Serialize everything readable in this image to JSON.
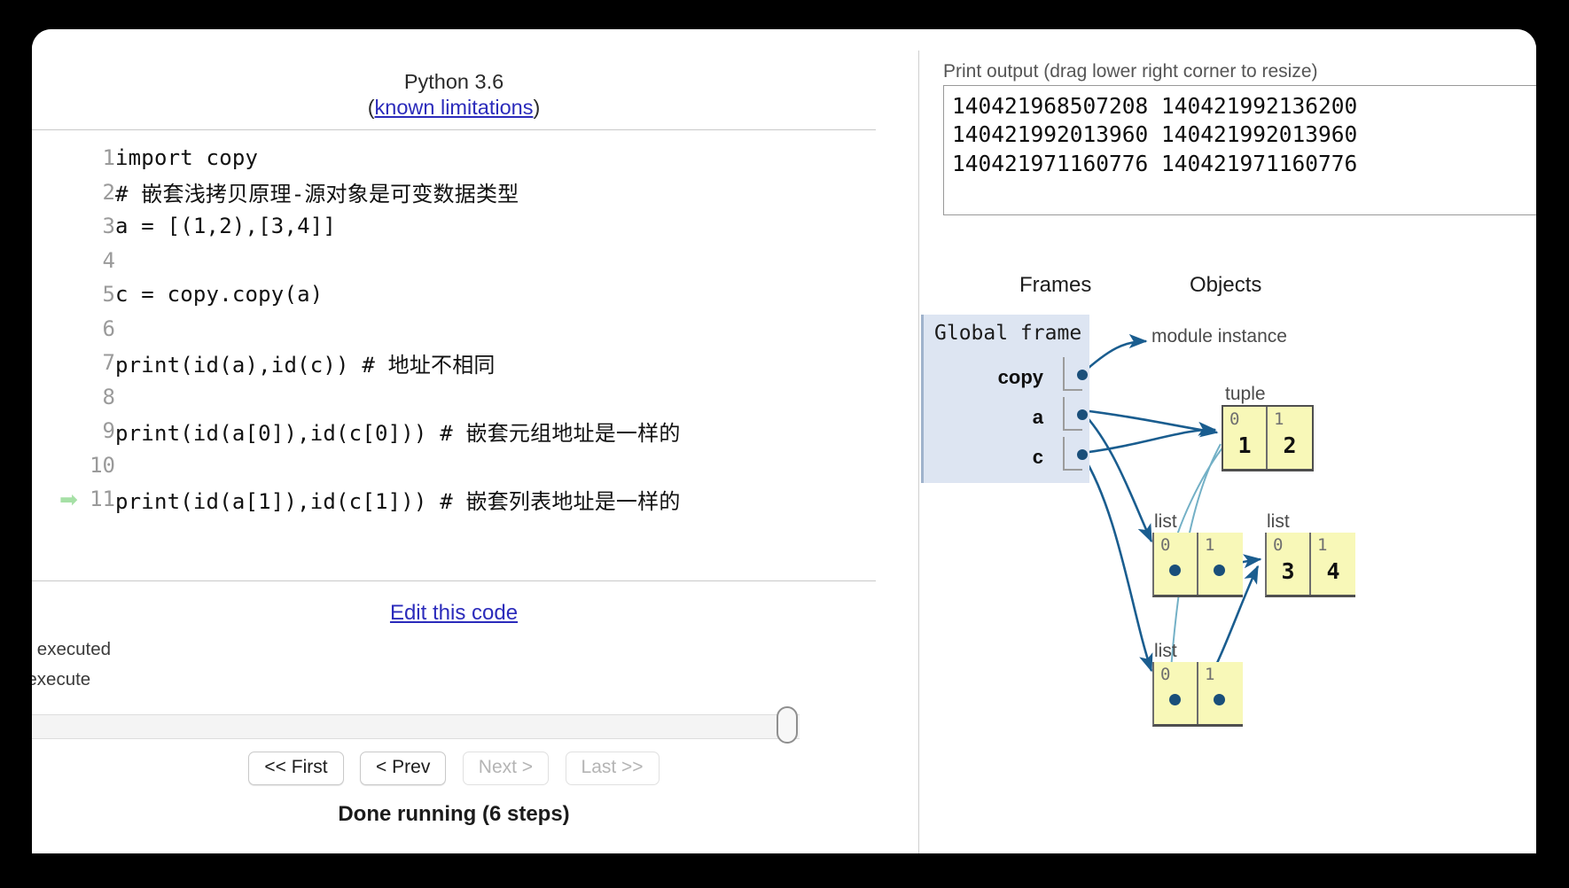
{
  "code_panel": {
    "python_version": "Python 3.6",
    "limitations_open_paren": "(",
    "limitations_link": "known limitations",
    "limitations_close_paren": ")",
    "lines": [
      {
        "number": "1",
        "text": "import copy",
        "current": false
      },
      {
        "number": "2",
        "text": "# 嵌套浅拷贝原理-源对象是可变数据类型",
        "current": false
      },
      {
        "number": "3",
        "text": "a = [(1,2),[3,4]]",
        "current": false
      },
      {
        "number": "4",
        "text": "",
        "current": false
      },
      {
        "number": "5",
        "text": "c = copy.copy(a)",
        "current": false
      },
      {
        "number": "6",
        "text": "",
        "current": false
      },
      {
        "number": "7",
        "text": "print(id(a),id(c)) # 地址不相同",
        "current": false
      },
      {
        "number": "8",
        "text": "",
        "current": false
      },
      {
        "number": "9",
        "text": "print(id(a[0]),id(c[0])) # 嵌套元组地址是一样的",
        "current": false
      },
      {
        "number": "10",
        "text": "",
        "current": false
      },
      {
        "number": "11",
        "text": "print(id(a[1]),id(c[1])) # 嵌套列表地址是一样的",
        "current": true
      }
    ],
    "edit_this_code": "Edit this code",
    "legend_executed": "hat just executed",
    "legend_next": "line to execute",
    "nav": {
      "first": "<< First",
      "prev": "< Prev",
      "next": "Next >",
      "last": "Last >>"
    },
    "status": "Done running (6 steps)"
  },
  "output_panel": {
    "print_output_label": "Print output (drag lower right corner to resize)",
    "print_output_lines": [
      "140421968507208 140421992136200",
      "140421992013960 140421992013960",
      "140421971160776 140421971160776"
    ],
    "frames_heading": "Frames",
    "objects_heading": "Objects",
    "global_frame_title": "Global frame",
    "frame_vars": [
      {
        "name": "copy"
      },
      {
        "name": "a"
      },
      {
        "name": "c"
      }
    ],
    "module_instance_label": "module instance",
    "objects": [
      {
        "id": "tuple",
        "label": "tuple",
        "cells": [
          {
            "index": "0",
            "value": "1",
            "is_pointer": false
          },
          {
            "index": "1",
            "value": "2",
            "is_pointer": false
          }
        ]
      },
      {
        "id": "list-a",
        "label": "list",
        "cells": [
          {
            "index": "0",
            "value": "",
            "is_pointer": true
          },
          {
            "index": "1",
            "value": "",
            "is_pointer": true
          }
        ]
      },
      {
        "id": "list-inner",
        "label": "list",
        "cells": [
          {
            "index": "0",
            "value": "3",
            "is_pointer": false
          },
          {
            "index": "1",
            "value": "4",
            "is_pointer": false
          }
        ]
      },
      {
        "id": "list-c",
        "label": "list",
        "cells": [
          {
            "index": "0",
            "value": "",
            "is_pointer": true
          },
          {
            "index": "1",
            "value": "",
            "is_pointer": true
          }
        ]
      }
    ]
  },
  "colors": {
    "frame_bg": "#dde5f2",
    "object_bg": "#f8f8b8",
    "pointer": "#1a4f7a",
    "link": "#2b2bbb",
    "current_line_arrow": "#a6e0a6"
  }
}
